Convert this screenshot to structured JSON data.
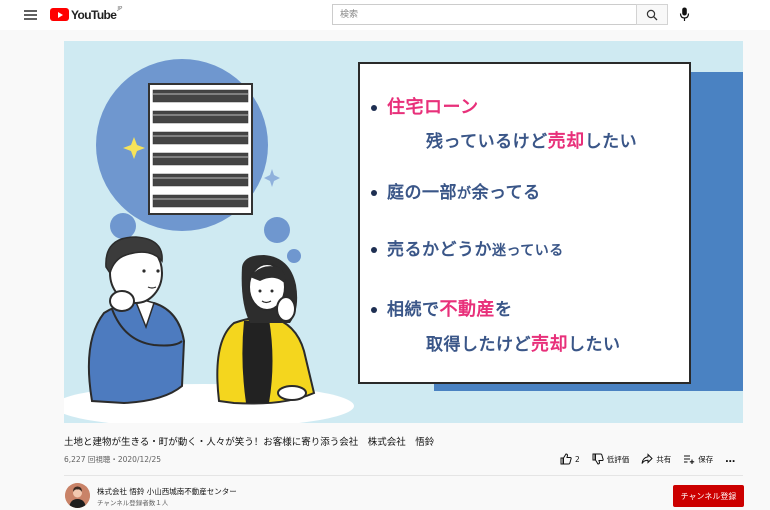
{
  "header": {
    "logo_text": "YouTube",
    "logo_country": "JP",
    "search_placeholder": "検索"
  },
  "thumbnail": {
    "items": [
      {
        "line1": "住宅ローン",
        "line2_pre": "残っているけど",
        "line2_pink": "売却",
        "line2_post": "したい"
      },
      {
        "text_pre": "庭の一部",
        "text_small": "が",
        "text_post": "余ってる"
      },
      {
        "text_pre": "売るかどうか",
        "text_small": "迷っている"
      },
      {
        "line1_pre": "相続で",
        "line1_pink": "不動産",
        "line1_post": "を",
        "line2_pre": "取得したけど",
        "line2_pink": "売却",
        "line2_post": "したい"
      }
    ]
  },
  "video": {
    "title": "土地と建物が生きる・町が動く・人々が笑う！お客様に寄り添う会社　株式会社　悟鈴",
    "meta": "6,227 回視聴・2020/12/25",
    "like_count": "2",
    "dislike_label": "低評価",
    "share_label": "共有",
    "save_label": "保存",
    "more_label": "…"
  },
  "channel": {
    "name": "株式会社 悟鈴 小山西城南不動産センター",
    "subscribers": "チャンネル登録者数１人",
    "subscribe_label": "チャンネル登録"
  },
  "colors": {
    "brand_red": "#ff0000",
    "subscribe_red": "#cc0000",
    "thumb_bg": "#cfeaf2",
    "accent_pink": "#e8307a",
    "accent_blue": "#4a82c2",
    "text_navy": "#3a5688"
  }
}
